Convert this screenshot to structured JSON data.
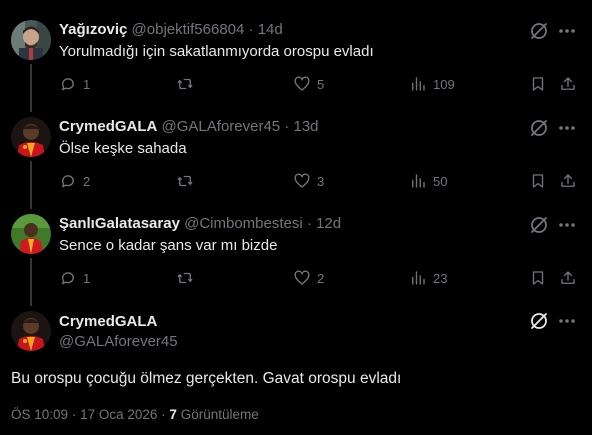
{
  "replies": [
    {
      "name": "Yağızoviç",
      "handle": "@objektif566804",
      "sep": "·",
      "time": "14d",
      "text": "Yorulmadığı için sakatlanmıyorda orospu evladı",
      "replies": "1",
      "reposts": "",
      "likes": "5",
      "views": "109"
    },
    {
      "name": "CrymedGALA",
      "handle": "@GALAforever45",
      "sep": "·",
      "time": "13d",
      "text": "Ölse keşke sahada",
      "replies": "2",
      "reposts": "",
      "likes": "3",
      "views": "50"
    },
    {
      "name": "ŞanlıGalatasaray",
      "handle": "@Cimbombestesi",
      "sep": "·",
      "time": "12d",
      "text": "Sence o kadar şans var mı bizde",
      "replies": "1",
      "reposts": "",
      "likes": "2",
      "views": "23"
    }
  ],
  "main": {
    "name": "CrymedGALA",
    "handle": "@GALAforever45",
    "text": "Bu orospu çocuğu ölmez gerçekten. Gavat orospu evladı",
    "time": "ÖS 10:09",
    "sep1": "·",
    "date": "17 Oca 2026",
    "sep2": "·",
    "views_count": "7",
    "views_label": "Görüntüleme"
  },
  "colors": {
    "background": "#000000",
    "text": "#e7e9ea",
    "muted": "#71767b",
    "thread_line": "#333639"
  }
}
